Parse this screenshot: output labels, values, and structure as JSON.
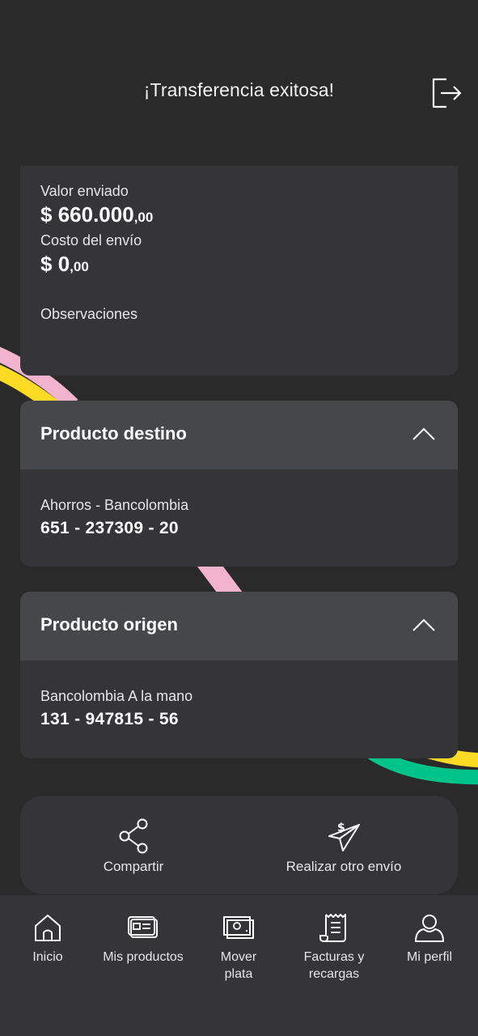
{
  "header": {
    "title": "¡Transferencia exitosa!",
    "logout_icon": "logout-icon"
  },
  "summary": {
    "sent_label": "Valor enviado",
    "sent_currency": "$",
    "sent_amount": "660.000",
    "sent_cents": ",00",
    "cost_label": "Costo del envío",
    "cost_currency": "$",
    "cost_amount": "0",
    "cost_cents": ",00",
    "notes_label": "Observaciones"
  },
  "destination": {
    "title": "Producto destino",
    "account_type": "Ahorros - Bancolombia",
    "account_number": "651 - 237309 - 20"
  },
  "origin": {
    "title": "Producto origen",
    "account_type": "Bancolombia A la mano",
    "account_number": "131 - 947815 - 56"
  },
  "actions": {
    "share_label": "Compartir",
    "resend_label": "Realizar otro envío"
  },
  "nav": {
    "items": [
      {
        "label": "Inicio",
        "icon": "home-icon"
      },
      {
        "label": "Mis productos",
        "icon": "card-icon"
      },
      {
        "label": "Mover plata",
        "icon": "money-icon"
      },
      {
        "label": "Facturas y recargas",
        "icon": "bill-icon"
      },
      {
        "label": "Mi perfil",
        "icon": "profile-icon"
      }
    ]
  },
  "colors": {
    "background": "#2a2a2a",
    "card": "#353538",
    "card_header": "#46474a",
    "stripe_pink": "#f2b3cf",
    "stripe_yellow": "#fdda24",
    "stripe_green": "#00c389"
  }
}
